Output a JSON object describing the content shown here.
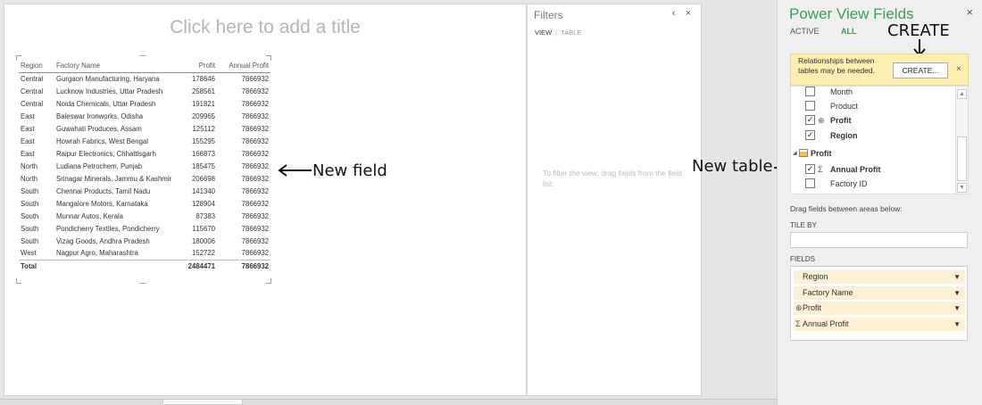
{
  "canvas": {
    "title_placeholder": "Click here to add a title",
    "table": {
      "headers": [
        "Region",
        "Factory Name",
        "Profit",
        "Annual Profit"
      ],
      "rows": [
        [
          "Central",
          "Gurgaon Manufacturing, Haryana",
          "178646",
          "7866932"
        ],
        [
          "Central",
          "Lucknow Industries, Uttar Pradesh",
          "258561",
          "7866932"
        ],
        [
          "Central",
          "Noida Chemicals, Uttar Pradesh",
          "191821",
          "7866932"
        ],
        [
          "East",
          "Baleswar Ironworks, Odisha",
          "209965",
          "7866932"
        ],
        [
          "East",
          "Guwahati Produces, Assam",
          "125112",
          "7866932"
        ],
        [
          "East",
          "Howrah Fabrics, West Bengal",
          "155295",
          "7866932"
        ],
        [
          "East",
          "Raipur Electronics, Chhattisgarh",
          "166873",
          "7866932"
        ],
        [
          "North",
          "Ludiana Petrochem, Punjab",
          "185475",
          "7866932"
        ],
        [
          "North",
          "Srinagar Minerals, Jammu & Kashmir",
          "206698",
          "7866932"
        ],
        [
          "South",
          "Chennai Products, Tamil Nadu",
          "141340",
          "7866932"
        ],
        [
          "South",
          "Mangalore Motors, Karnataka",
          "128904",
          "7866932"
        ],
        [
          "South",
          "Munnar Autos, Kerala",
          "87383",
          "7866932"
        ],
        [
          "South",
          "Pondicherry Textiles, Pondicherry",
          "115670",
          "7866932"
        ],
        [
          "South",
          "Vizag Goods, Andhra Pradesh",
          "180006",
          "7866932"
        ],
        [
          "West",
          "Nagpur Agro, Maharashtra",
          "152722",
          "7866932"
        ]
      ],
      "total": [
        "Total",
        "",
        "2484471",
        "7866932"
      ]
    }
  },
  "annotations": {
    "new_field": "New field",
    "new_table": "New table",
    "create": "CREATE"
  },
  "filters": {
    "title": "Filters",
    "controls": "‹ ×",
    "tab_view": "VIEW",
    "tab_table": "TABLE",
    "hint": "To filter the view, drag fields from the field list."
  },
  "fields_pane": {
    "title": "Power View Fields",
    "close": "×",
    "tab_active": "ACTIVE",
    "tab_all": "ALL",
    "notice": {
      "text": "Relationships between tables may be needed.",
      "create_button": "CREATE...",
      "close": "×"
    },
    "list": [
      {
        "label": "Month",
        "checked": false,
        "icon": "",
        "bold": false
      },
      {
        "label": "Product",
        "checked": false,
        "icon": "",
        "bold": false
      },
      {
        "label": "Profit",
        "checked": true,
        "icon": "globe-icon",
        "bold": true
      },
      {
        "label": "Region",
        "checked": true,
        "icon": "",
        "bold": true
      },
      {
        "label": "Profit",
        "checked": null,
        "icon": "table-icon",
        "bold": true,
        "group": true
      },
      {
        "label": "Annual Profit",
        "checked": true,
        "icon": "sigma-icon",
        "bold": true
      },
      {
        "label": "Factory ID",
        "checked": false,
        "icon": "",
        "bold": false
      }
    ],
    "drag_hint": "Drag fields between areas below:",
    "tile_by_label": "TILE BY",
    "fields_label": "FIELDS",
    "wells": [
      {
        "label": "Region",
        "icon": ""
      },
      {
        "label": "Factory Name",
        "icon": ""
      },
      {
        "label": "Profit",
        "icon": "globe-icon"
      },
      {
        "label": "Annual Profit",
        "icon": "sigma-icon"
      }
    ]
  }
}
